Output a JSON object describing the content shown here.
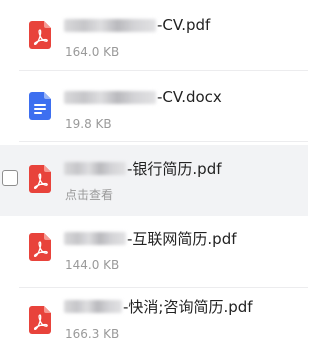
{
  "files": [
    {
      "name_suffix": "-CV.pdf",
      "subtext": "164.0 KB",
      "type": "pdf",
      "hovered": false
    },
    {
      "name_suffix": "-CV.docx",
      "subtext": "19.8 KB",
      "type": "docx",
      "hovered": false
    },
    {
      "name_suffix": "-银行简历.pdf",
      "subtext": "点击查看",
      "type": "pdf",
      "hovered": true
    },
    {
      "name_suffix": "-互联网简历.pdf",
      "subtext": "144.0 KB",
      "type": "pdf",
      "hovered": false
    },
    {
      "name_suffix": "-快消;咨询简历.pdf",
      "subtext": "166.3 KB",
      "type": "pdf",
      "hovered": false
    }
  ],
  "colors": {
    "pdf_icon": "#e8433b",
    "docx_icon": "#3d6ff0",
    "hover_background": "#f2f3f5",
    "subtext": "#9a9a9a"
  },
  "icons": {
    "pdf": "pdf-file-icon",
    "docx": "word-document-icon"
  }
}
